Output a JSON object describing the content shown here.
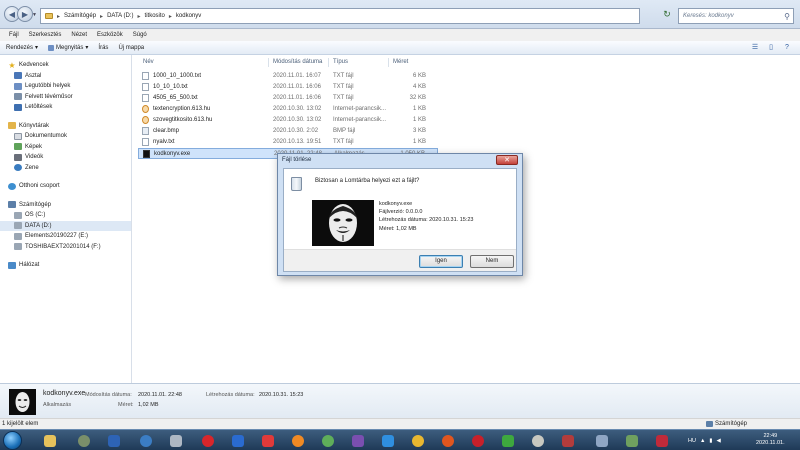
{
  "address": {
    "crumbs": [
      "Számítógép",
      "DATA (D:)",
      "titkosito",
      "kodkonyv"
    ],
    "search_placeholder": "Keresés: kodkonyv"
  },
  "menubar": [
    "Fájl",
    "Szerkesztés",
    "Nézet",
    "Eszközök",
    "Súgó"
  ],
  "toolbar": {
    "organize": "Rendezés",
    "open": "Megnyitás",
    "burn": "Írás",
    "new_folder": "Új mappa"
  },
  "nav": {
    "favorites": "Kedvencek",
    "fav_items": [
      "Asztal",
      "Legutóbbi helyek",
      "Felvett tévéműsor",
      "Letöltések"
    ],
    "libraries": "Könyvtárak",
    "lib_items": [
      "Dokumentumok",
      "Képek",
      "Videók",
      "Zene"
    ],
    "homegroup": "Otthoni csoport",
    "computer": "Számítógép",
    "drives": [
      "OS (C:)",
      "DATA (D:)",
      "Elements20190227 (E:)",
      "TOSHIBAEXT20201014 (F:)"
    ],
    "network": "Hálózat"
  },
  "columns": {
    "name": "Név",
    "modified": "Módosítás dátuma",
    "type": "Típus",
    "size": "Méret"
  },
  "files": [
    {
      "name": "1000_10_1000.txt",
      "modified": "2020.11.01. 16:07",
      "type": "TXT fájl",
      "size": "6 KB"
    },
    {
      "name": "10_10_10.txt",
      "modified": "2020.11.01. 16:06",
      "type": "TXT fájl",
      "size": "4 KB"
    },
    {
      "name": "4505_65_500.txt",
      "modified": "2020.11.01. 16:06",
      "type": "TXT fájl",
      "size": "32 KB"
    },
    {
      "name": "textencryption.613.hu",
      "modified": "2020.10.30. 13:02",
      "type": "Internet-parancsik...",
      "size": "1 KB"
    },
    {
      "name": "szovegtitkosito.613.hu",
      "modified": "2020.10.30. 13:02",
      "type": "Internet-parancsik...",
      "size": "1 KB"
    },
    {
      "name": "clear.bmp",
      "modified": "2020.10.30. 2:02",
      "type": "BMP fájl",
      "size": "3 KB"
    },
    {
      "name": "nyalv.txt",
      "modified": "2020.10.13. 19:51",
      "type": "TXT fájl",
      "size": "1 KB"
    },
    {
      "name": "kodkonyv.exe",
      "modified": "2020.11.01. 22:48",
      "type": "Alkalmazás",
      "size": "1 050 KB"
    }
  ],
  "dialog": {
    "title": "Fájl törlése",
    "question": "Biztosan a Lomtárba helyezi ezt a fájlt?",
    "filename": "kodkonyv.exe",
    "version": "Fájlverzió: 0.0.0.0",
    "created": "Létrehozás dátuma: 2020.10.31. 15:23",
    "size": "Méret: 1,02 MB",
    "yes": "Igen",
    "no": "Nem"
  },
  "details": {
    "name": "kodkonyv.exe",
    "type": "Alkalmazás",
    "modified_label": "Módosítás dátuma:",
    "modified_value": "2020.11.01. 22:48",
    "size_label": "Méret:",
    "size_value": "1,02 MB",
    "created_label": "Létrehozás dátuma:",
    "created_value": "2020.10.31. 15:23"
  },
  "status": {
    "selected": "1 kijelölt elem",
    "location": "Számítógép"
  },
  "tray": {
    "lang": "HU",
    "time": "22:49",
    "date": "2020.11.01."
  },
  "colors": {
    "selection": "#cfe3fb",
    "taskbar": "#1f3a57"
  }
}
